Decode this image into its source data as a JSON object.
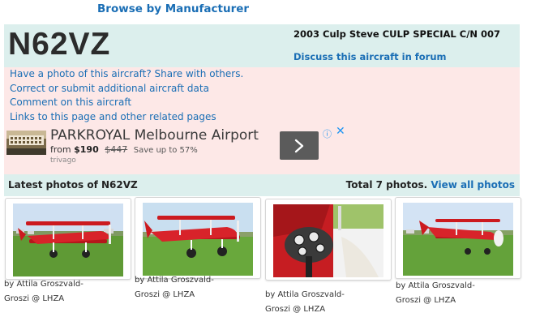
{
  "top": {
    "browse_label": "Browse by Manufacturer"
  },
  "aircraft": {
    "registration": "N62VZ",
    "title": "2003 Culp Steve CULP SPECIAL C/N 007",
    "discuss_label": "Discuss this aircraft in forum"
  },
  "links": [
    "Have a photo of this aircraft? Share with others.",
    "Correct or submit additional aircraft data",
    "Comment on this aircraft",
    "Links to this page and other related pages"
  ],
  "ad": {
    "title": "PARKROYAL Melbourne Airport",
    "price_label": "from",
    "price": "$190",
    "old_price": "$447",
    "savings": "Save up to 57%",
    "brand": "trivago",
    "info_icon": "info-icon",
    "close_icon": "close-icon"
  },
  "photos": {
    "heading": "Latest photos of N62VZ",
    "total": "Total 7 photos.",
    "view_all": "View all photos",
    "items": [
      {
        "caption_line1": "by Attila Groszvald-",
        "caption_line2": "Groszi @ LHZA"
      },
      {
        "caption_line1": "by Attila Groszvald-",
        "caption_line2": "Groszi @ LHZA"
      },
      {
        "caption_line1": "by Attila Groszvald-",
        "caption_line2": "Groszi @ LHZA"
      },
      {
        "caption_line1": "by Attila Groszvald-",
        "caption_line2": "Groszi @ LHZA"
      }
    ]
  },
  "colors": {
    "link": "#1a6eb5",
    "header_bg": "#dcefed",
    "links_bg": "#fde8e7",
    "plane_red": "#cc1a1f",
    "grass": "#5f9a35",
    "sky": "#cfe0f2"
  }
}
